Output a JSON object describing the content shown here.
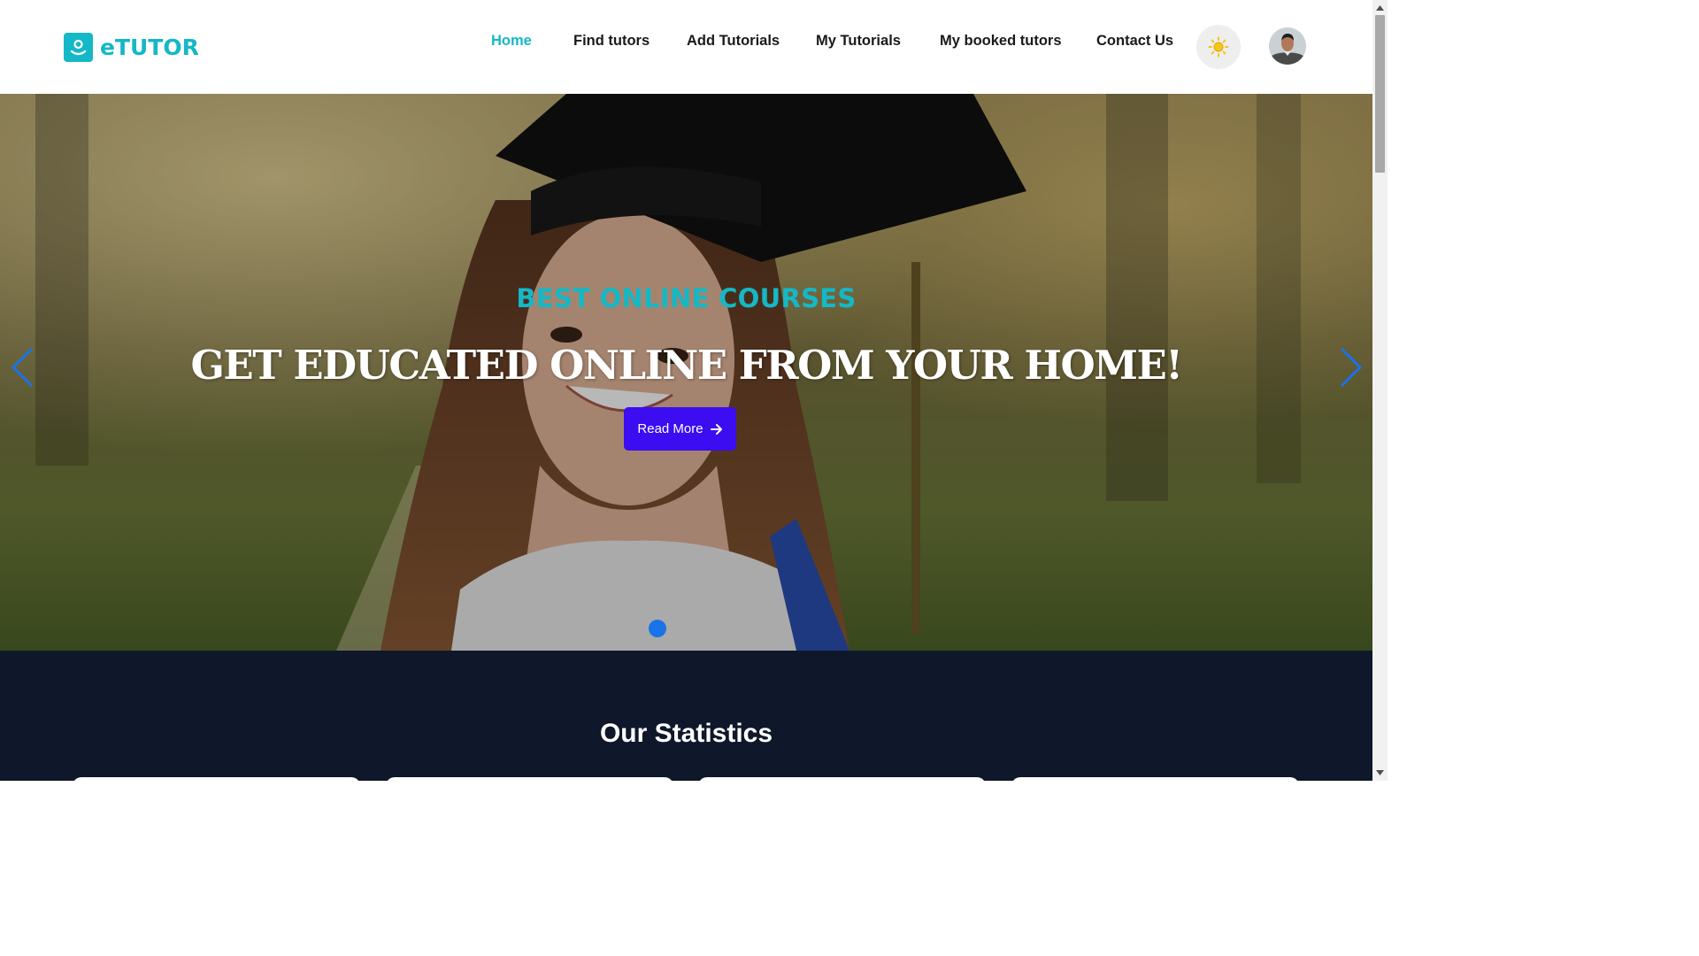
{
  "brand": {
    "name": "eTUTOR",
    "logo_icon": "user-badge-icon",
    "color": "#14b8c6"
  },
  "nav": {
    "items": [
      {
        "label": "Home",
        "active": true
      },
      {
        "label": "Find tutors",
        "active": false
      },
      {
        "label": "Add Tutorials",
        "active": false
      },
      {
        "label": "My Tutorials",
        "active": false
      },
      {
        "label": "My booked tutors",
        "active": false
      },
      {
        "label": "Contact Us",
        "active": false
      }
    ],
    "theme_toggle_icon": "sun-icon",
    "avatar_icon": "user-avatar"
  },
  "hero": {
    "subtitle": "BEST ONLINE COURSES",
    "title": "GET EDUCATED ONLINE FROM YOUR HOME!",
    "button_label": "Read More",
    "button_icon": "arrow-right-icon",
    "button_color": "#3b0df0",
    "prev_icon": "chevron-left-icon",
    "next_icon": "chevron-right-icon",
    "slide_indicator_color": "#1a73e8"
  },
  "stats": {
    "title": "Our Statistics",
    "background": "#0f172a"
  }
}
